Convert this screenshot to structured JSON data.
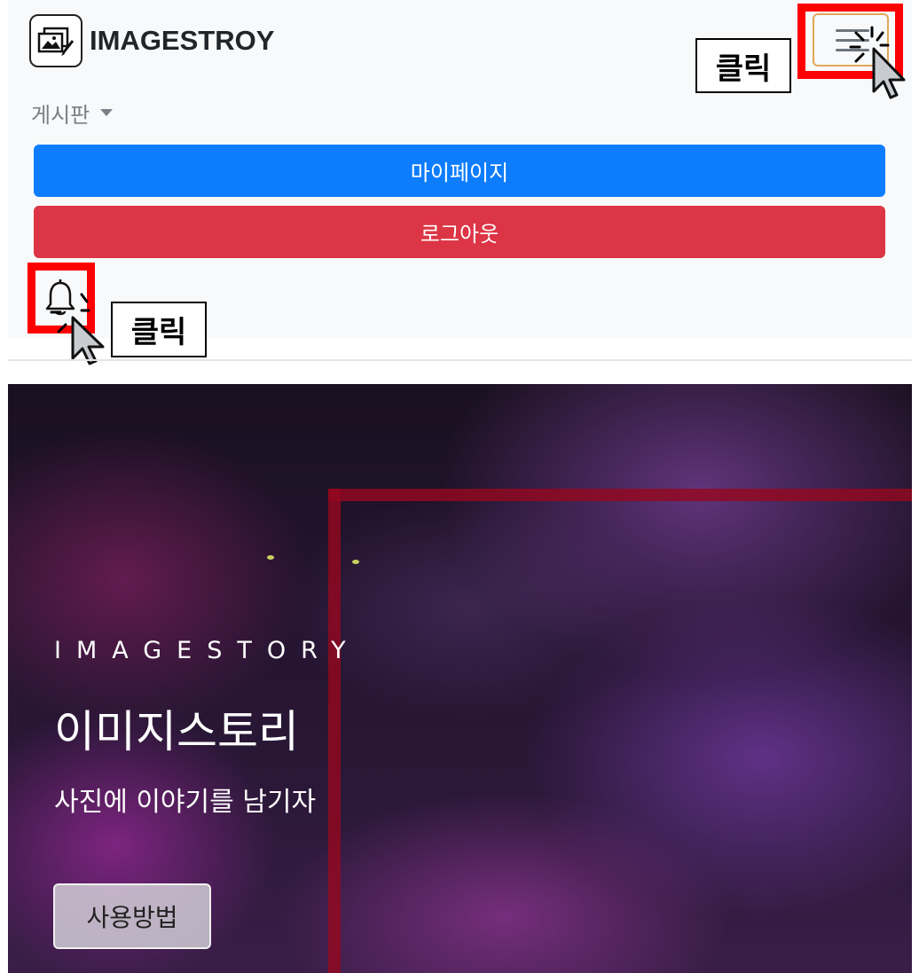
{
  "navbar": {
    "brand_name": "IMAGESTROY",
    "brand_logo_icon": "image-edit-icon",
    "toggler_icon": "hamburger-menu-icon",
    "board_dropdown_label": "게시판",
    "mypage_label": "마이페이지",
    "logout_label": "로그아웃",
    "notification_icon": "bell-icon"
  },
  "annotations": {
    "menu_click_label": "클릭",
    "bell_click_label": "클릭"
  },
  "hero": {
    "kicker": "IMAGESTORY",
    "title": "이미지스토리",
    "subtitle": "사진에 이야기를 남기자",
    "guide_button_label": "사용방법"
  },
  "colors": {
    "primary": "#0d7dfd",
    "danger": "#dc3545",
    "highlight": "#ff0000",
    "navbar_bg": "#f8f9fa"
  }
}
